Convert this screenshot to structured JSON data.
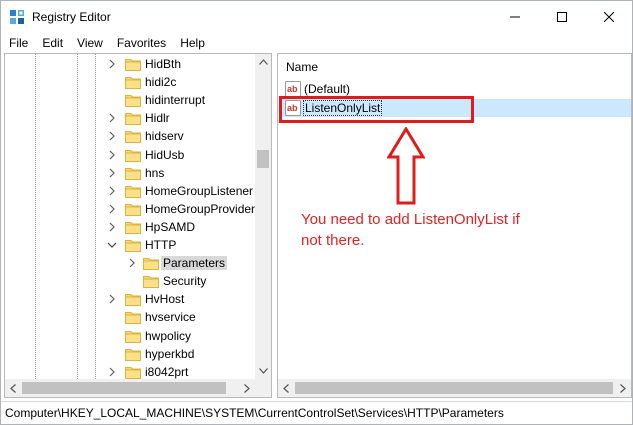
{
  "window": {
    "title": "Registry Editor",
    "controls": [
      "minimize",
      "maximize",
      "close"
    ]
  },
  "menu": [
    "File",
    "Edit",
    "View",
    "Favorites",
    "Help"
  ],
  "tree": {
    "items": [
      {
        "label": "HidBth",
        "expander": "collapsed"
      },
      {
        "label": "hidi2c",
        "expander": "none"
      },
      {
        "label": "hidinterrupt",
        "expander": "none"
      },
      {
        "label": "Hidlr",
        "expander": "collapsed"
      },
      {
        "label": "hidserv",
        "expander": "collapsed"
      },
      {
        "label": "HidUsb",
        "expander": "collapsed"
      },
      {
        "label": "hns",
        "expander": "collapsed"
      },
      {
        "label": "HomeGroupListener",
        "expander": "collapsed"
      },
      {
        "label": "HomeGroupProvider",
        "expander": "collapsed"
      },
      {
        "label": "HpSAMD",
        "expander": "collapsed"
      },
      {
        "label": "HTTP",
        "expander": "expanded"
      },
      {
        "label": "Parameters",
        "expander": "collapsed",
        "selected": true
      },
      {
        "label": "Security",
        "expander": "none"
      },
      {
        "label": "HvHost",
        "expander": "collapsed"
      },
      {
        "label": "hvservice",
        "expander": "none"
      },
      {
        "label": "hwpolicy",
        "expander": "none"
      },
      {
        "label": "hyperkbd",
        "expander": "none"
      },
      {
        "label": "i8042prt",
        "expander": "collapsed"
      }
    ]
  },
  "list": {
    "column_header": "Name",
    "values": [
      {
        "name": "(Default)",
        "icon": "string-value-icon"
      },
      {
        "name": "ListenOnlyList",
        "icon": "string-value-icon",
        "selected": true
      }
    ]
  },
  "annotation": {
    "note_line1": "You need to add ListenOnlyList if",
    "note_line2": "not there.",
    "color": "#e02424"
  },
  "status_bar": {
    "path": "Computer\\HKEY_LOCAL_MACHINE\\SYSTEM\\CurrentControlSet\\Services\\HTTP\\Parameters"
  },
  "colors": {
    "selection": "#cce8ff",
    "tree_selection": "#d9d9d9",
    "folder": "#f8d775",
    "folder_edge": "#dcb33f",
    "annotation_red": "#e01b1b"
  }
}
